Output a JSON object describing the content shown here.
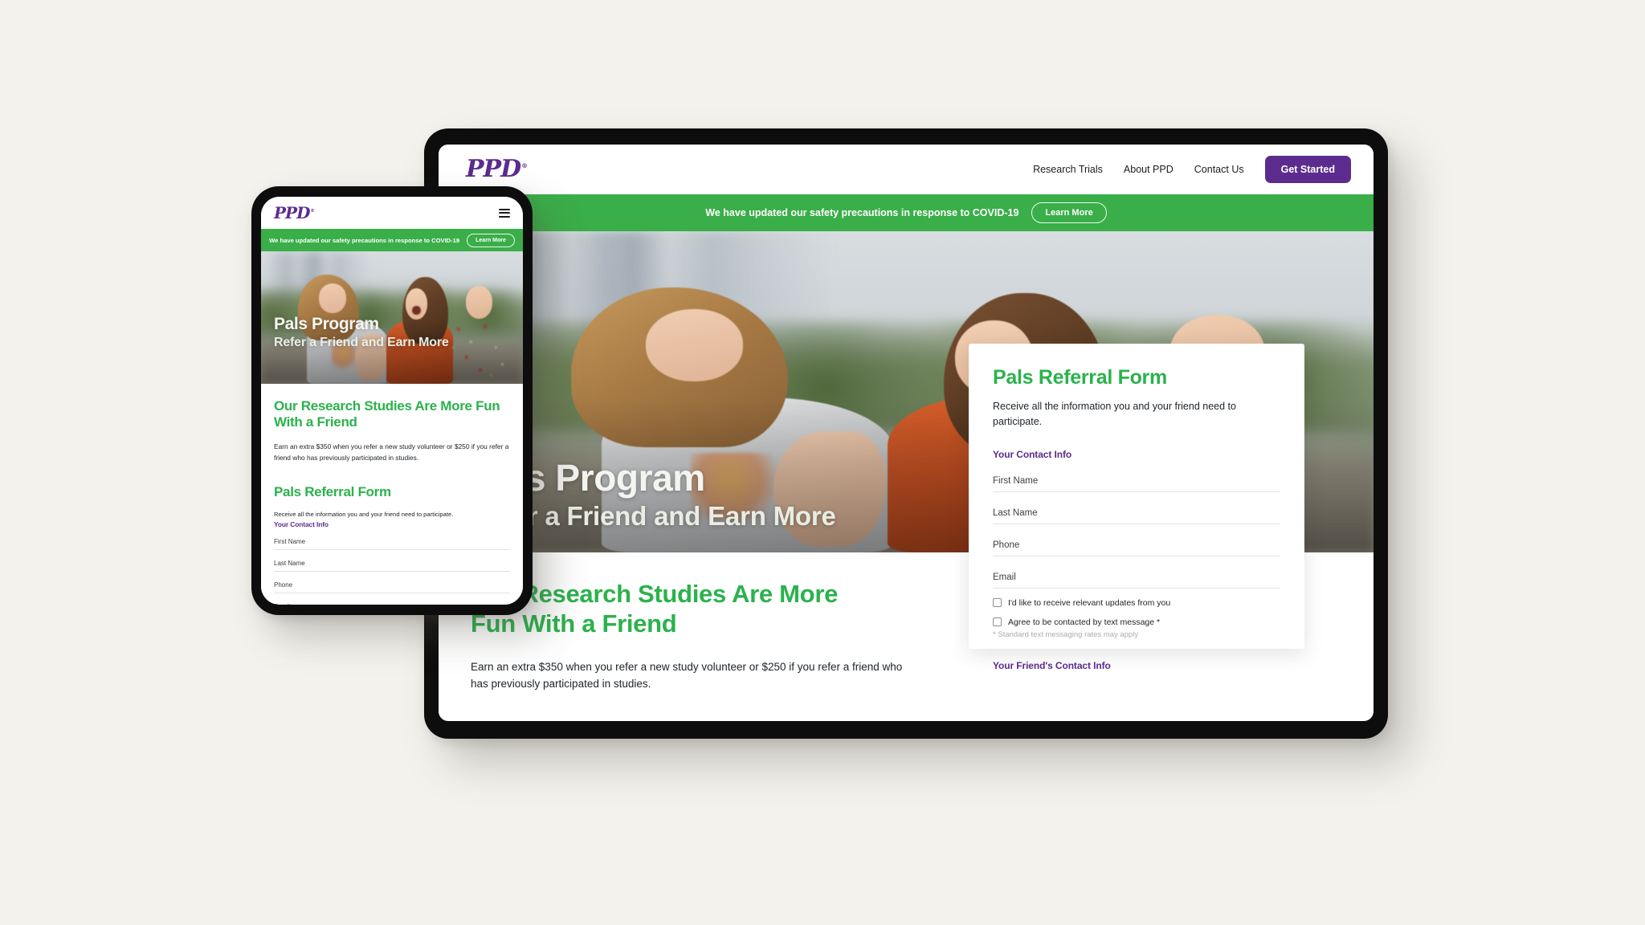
{
  "brand": {
    "logo_text": "PPD",
    "purple": "#5B2C8D",
    "green": "#3AAE49",
    "heading_green": "#2BB24C",
    "page_background": "#F3F2ED"
  },
  "nav": {
    "links": [
      {
        "label": "Research Trials"
      },
      {
        "label": "About PPD"
      },
      {
        "label": "Contact Us"
      }
    ],
    "cta_label": "Get Started",
    "menu_icon": "hamburger-icon"
  },
  "banner": {
    "text": "We have updated our safety precautions in response to COVID-19",
    "button_label": "Learn More"
  },
  "hero": {
    "title": "Pals Program",
    "subtitle": "Refer a Friend and Earn More"
  },
  "section": {
    "title_tablet": "Our Research Studies Are More Fun With a Friend",
    "title_phone": "Our Research Studies Are More Fun With a Friend",
    "paragraph": "Earn an extra $350 when you refer a new study volunteer or $250 if you refer a friend who has previously participated in studies."
  },
  "form": {
    "title": "Pals Referral Form",
    "lede": "Receive all the information you and your friend need to participate.",
    "legend_you": "Your Contact Info",
    "legend_friend": "Your Friend's Contact Info",
    "fields": [
      {
        "label": "First Name",
        "value": "",
        "placeholder": "First Name"
      },
      {
        "label": "Last Name",
        "value": "",
        "placeholder": "Last Name"
      },
      {
        "label": "Phone",
        "value": "",
        "placeholder": "Phone"
      },
      {
        "label": "Email",
        "value": "",
        "placeholder": "Email"
      }
    ],
    "checkboxes": [
      {
        "label": "I'd like to receive relevant updates from you",
        "checked": false
      },
      {
        "label": "Agree to be contacted by text message *",
        "checked": false
      }
    ],
    "fine_print": "* Standard text messaging rates may apply"
  }
}
